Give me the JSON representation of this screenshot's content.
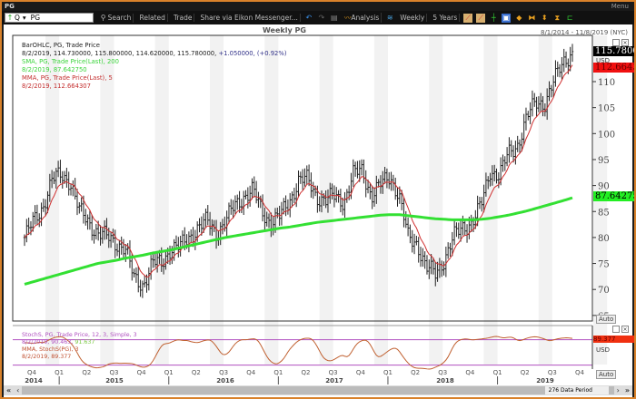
{
  "window": {
    "title": "PG",
    "menu": "Menu"
  },
  "toolbar": {
    "symbol": "PG",
    "q": "Q",
    "search": "Search",
    "related": "Related",
    "trade": "Trade",
    "share": "Share via Eikon Messenger...",
    "analysis": "Analysis",
    "interval": "Weekly",
    "range": "5 Years"
  },
  "chart": {
    "title": "Weekly PG",
    "date_range": "8/1/2014 - 11/8/2019 (NYC)",
    "legend": [
      {
        "text": "BarOHLC, PG, Trade Price",
        "color": "#222"
      },
      {
        "text": "8/2/2019, 114.730000, 115.800000, 114.620000, 115.780000,",
        "color": "#222",
        "extra": " +1.050000, (+0.92%)",
        "extra_color": "#33338a"
      },
      {
        "text": "SMA, PG, Trade Price(Last),  200",
        "color": "#3bd43b"
      },
      {
        "text": "8/2/2019, 87.642750",
        "color": "#3bd43b"
      },
      {
        "text": "MMA, PG, Trade Price(Last),  5",
        "color": "#c43030"
      },
      {
        "text": "8/2/2019, 112.664307",
        "color": "#c43030"
      }
    ],
    "last_price": "115.7800",
    "mma_value": "112.6643",
    "sma_value": "87.64275",
    "currency": "USD",
    "auto": "Auto",
    "y_ticks": [
      "110",
      "105",
      "100",
      "95",
      "90",
      "85",
      "80",
      "75",
      "70",
      "65"
    ],
    "stoch_legend": [
      {
        "text": "StochS, PG, Trade Price,  12, 3, Simple, 3",
        "color": "#b050c0"
      },
      {
        "text": "8/2/2019, 90.463, ",
        "color": "#b050c0",
        "extra": "91.637",
        "extra_color": "#7ac943"
      },
      {
        "text": "MMA, StochS(PG),  3",
        "color": "#c05030"
      },
      {
        "text": "8/2/2019, 89.377",
        "color": "#c05030"
      }
    ],
    "stoch_value": "89.377",
    "quarters": [
      "Q4",
      "Q1",
      "Q2",
      "Q3",
      "Q4",
      "Q1",
      "Q2",
      "Q3",
      "Q4",
      "Q1",
      "Q2",
      "Q3",
      "Q4",
      "Q1",
      "Q2",
      "Q3",
      "Q4",
      "Q1",
      "Q2",
      "Q3",
      "Q4"
    ],
    "years": [
      "2014",
      "2015",
      "2016",
      "2017",
      "2018",
      "2019"
    ],
    "data_periods": "276 Data Period"
  },
  "chart_data": {
    "type": "ohlc",
    "title": "Weekly PG",
    "x_start": "2014-08",
    "x_end": "2019-08",
    "ylim": [
      63,
      118
    ],
    "monthly_close": [
      80,
      83,
      86,
      91,
      92,
      91,
      85,
      83,
      81,
      80,
      79,
      78,
      72,
      71,
      75,
      75,
      78,
      78,
      80,
      82,
      83,
      81,
      83,
      86,
      88,
      89,
      85,
      83,
      84,
      87,
      91,
      91,
      88,
      87,
      88,
      87,
      92,
      93,
      88,
      90,
      92,
      88,
      80,
      79,
      74,
      73,
      76,
      80,
      82,
      83,
      86,
      93,
      92,
      96,
      98,
      103,
      106,
      106,
      110,
      114,
      115.78
    ],
    "sma200_monthly": [
      71,
      71.5,
      72,
      72.5,
      73,
      73.5,
      74,
      74.5,
      75,
      75.3,
      75.6,
      76,
      76.3,
      76.6,
      77,
      77.3,
      77.6,
      78,
      78.4,
      78.8,
      79.2,
      79.6,
      80,
      80.3,
      80.6,
      80.9,
      81.2,
      81.5,
      81.8,
      82,
      82.3,
      82.6,
      82.9,
      83.1,
      83.3,
      83.5,
      83.7,
      83.9,
      84.1,
      84.3,
      84.4,
      84.4,
      84.2,
      84,
      83.8,
      83.6,
      83.5,
      83.4,
      83.4,
      83.4,
      83.5,
      83.7,
      84,
      84.3,
      84.7,
      85.1,
      85.6,
      86.1,
      86.6,
      87.1,
      87.64
    ]
  }
}
